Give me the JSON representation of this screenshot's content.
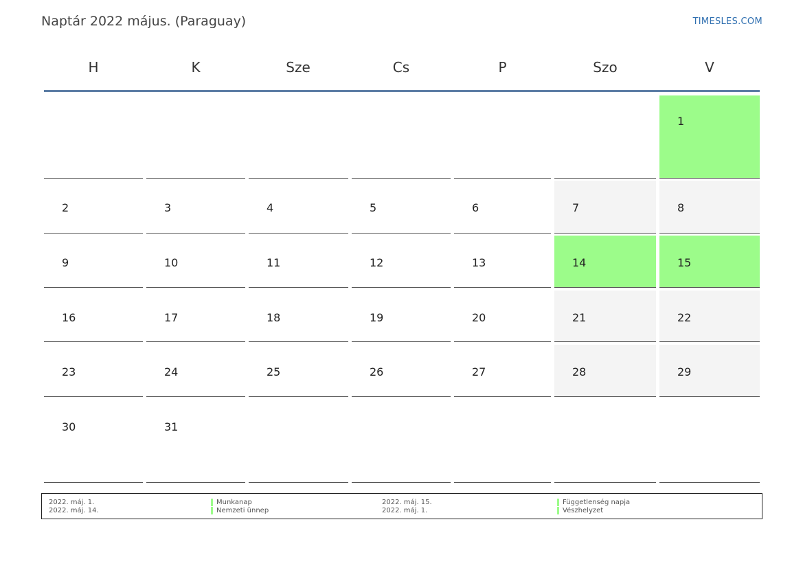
{
  "header": {
    "title": "Naptár 2022 május. (Paraguay)",
    "brand": "TIMESLES.COM"
  },
  "colors": {
    "holiday": "#9cfc8a",
    "weekend": "#f4f4f4",
    "header_line": "#5d7da5",
    "brand": "#2f6fb0"
  },
  "weekdays": [
    "H",
    "K",
    "Sze",
    "Cs",
    "P",
    "Szo",
    "V"
  ],
  "weeks": [
    [
      "",
      "",
      "",
      "",
      "",
      "",
      "1"
    ],
    [
      "2",
      "3",
      "4",
      "5",
      "6",
      "7",
      "8"
    ],
    [
      "9",
      "10",
      "11",
      "12",
      "13",
      "14",
      "15"
    ],
    [
      "16",
      "17",
      "18",
      "19",
      "20",
      "21",
      "22"
    ],
    [
      "23",
      "24",
      "25",
      "26",
      "27",
      "28",
      "29"
    ],
    [
      "30",
      "31",
      "",
      "",
      "",
      "",
      ""
    ]
  ],
  "holiday_days": [
    "1",
    "14",
    "15"
  ],
  "legend": [
    {
      "date": "2022. máj. 1.",
      "label": "Munkanap"
    },
    {
      "date": "2022. máj. 14.",
      "label": "Nemzeti ünnep"
    },
    {
      "date": "2022. máj. 15.",
      "label": "Függetlenség napja"
    },
    {
      "date": "2022. máj. 1.",
      "label": "Vészhelyzet"
    }
  ]
}
